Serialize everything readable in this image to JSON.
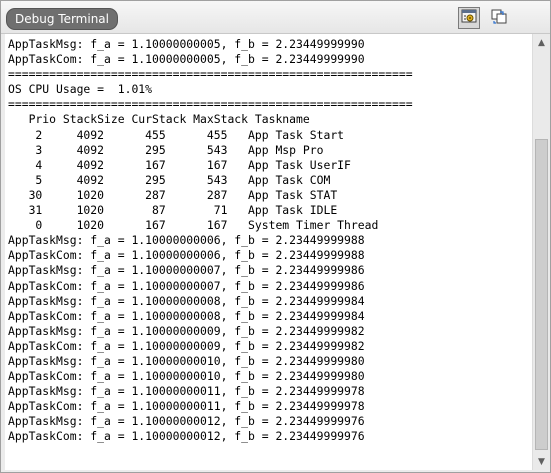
{
  "window": {
    "title": "Debug Terminal",
    "toolbar": {
      "settings_icon": "terminal-settings-icon",
      "copy_icon": "copy-output-icon"
    }
  },
  "terminal": {
    "lines": [
      "AppTaskMsg: f_a = 1.10000000005, f_b = 2.23449999990",
      "AppTaskCom: f_a = 1.10000000005, f_b = 2.23449999990",
      "===========================================================",
      "OS CPU Usage =  1.01%",
      "===========================================================",
      "   Prio StackSize CurStack MaxStack Taskname",
      "    2     4092      455      455   App Task Start",
      "    3     4092      295      543   App Msp Pro",
      "    4     4092      167      167   App Task UserIF",
      "    5     4092      295      543   App Task COM",
      "   30     1020      287      287   App Task STAT",
      "   31     1020       87       71   App Task IDLE",
      "    0     1020      167      167   System Timer Thread",
      "AppTaskMsg: f_a = 1.10000000006, f_b = 2.23449999988",
      "AppTaskCom: f_a = 1.10000000006, f_b = 2.23449999988",
      "AppTaskMsg: f_a = 1.10000000007, f_b = 2.23449999986",
      "AppTaskCom: f_a = 1.10000000007, f_b = 2.23449999986",
      "AppTaskMsg: f_a = 1.10000000008, f_b = 2.23449999984",
      "AppTaskCom: f_a = 1.10000000008, f_b = 2.23449999984",
      "AppTaskMsg: f_a = 1.10000000009, f_b = 2.23449999982",
      "AppTaskCom: f_a = 1.10000000009, f_b = 2.23449999982",
      "AppTaskMsg: f_a = 1.10000000010, f_b = 2.23449999980",
      "AppTaskCom: f_a = 1.10000000010, f_b = 2.23449999980",
      "AppTaskMsg: f_a = 1.10000000011, f_b = 2.23449999978",
      "AppTaskCom: f_a = 1.10000000011, f_b = 2.23449999978",
      "AppTaskMsg: f_a = 1.10000000012, f_b = 2.23449999976",
      "AppTaskCom: f_a = 1.10000000012, f_b = 2.23449999976"
    ]
  },
  "scrollbar": {
    "up_icon": "scroll-up-arrow-icon",
    "down_icon": "scroll-down-arrow-icon"
  },
  "colors": {
    "title_tab_bg": "#6f6f6f",
    "terminal_bg": "#ffffff",
    "text": "#000000"
  }
}
